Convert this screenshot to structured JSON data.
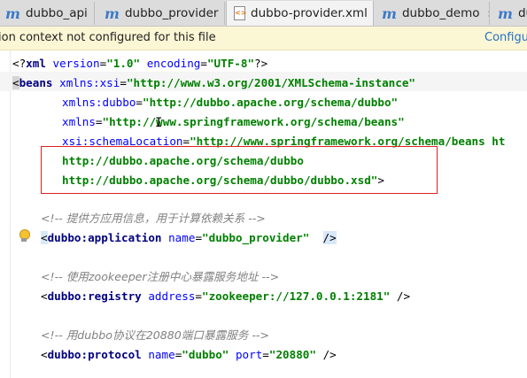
{
  "tabs": [
    {
      "label": "dubbo_api",
      "icon": "m-module-icon",
      "active": false
    },
    {
      "label": "dubbo_provider",
      "icon": "m-module-icon",
      "active": false
    },
    {
      "label": "dubbo-provider.xml",
      "icon": "xml-file-icon",
      "active": true
    },
    {
      "label": "dubbo_demo",
      "icon": "m-module-icon",
      "active": false
    },
    {
      "label": "du",
      "icon": "m-module-icon",
      "active": false
    }
  ],
  "close_glyph": "×",
  "notice": {
    "text": "ion context not configured for this file",
    "action": "Configu"
  },
  "code": {
    "l1": {
      "open": "<?",
      "tag": "xml",
      "a1": "version",
      "v1": "\"1.0\"",
      "a2": "encoding",
      "v2": "\"UTF-8\"",
      "close": "?>"
    },
    "l2": {
      "open": "<",
      "tag": "beans",
      "attr": "xmlns:xsi",
      "val": "\"http://www.w3.org/2001/XMLSchema-instance\""
    },
    "l3": {
      "attr": "xmlns:dubbo",
      "val": "\"http://dubbo.apache.org/schema/dubbo\""
    },
    "l4": {
      "attr": "xmlns",
      "val": "\"http://www.springframework.org/schema/beans\""
    },
    "l5": {
      "attr": "xsi:schemaLocation",
      "val": "\"http://www.springframework.org/schema/beans ht"
    },
    "l6": {
      "val": "http://dubbo.apache.org/schema/dubbo"
    },
    "l7": {
      "val": "http://dubbo.apache.org/schema/dubbo/dubbo.xsd\"",
      "close": ">"
    },
    "c1": "<!-- 提供方应用信息，用于计算依赖关系 -->",
    "l8": {
      "open": "<",
      "tag": "dubbo:application",
      "attr": "name",
      "val": "\"dubbo_provider\"",
      "close": "/>"
    },
    "c2": "<!-- 使用zookeeper注册中心暴露服务地址 -->",
    "l9": {
      "open": "<",
      "tag": "dubbo:registry",
      "attr": "address",
      "val": "\"zookeeper://127.0.0.1:2181\"",
      "close": "/>"
    },
    "c3": "<!-- 用dubbo协议在20880端口暴露服务 -->",
    "l10": {
      "open": "<",
      "tag": "dubbo:protocol",
      "attr": "name",
      "val": "\"dubbo\"",
      "attr2": "port",
      "val2": "\"20880\"",
      "close": "/>"
    }
  },
  "colors": {
    "tag": "#000080",
    "attribute": "#0000ff",
    "value": "#008000",
    "comment": "#808080",
    "annotation_box": "#e02020",
    "notice_bg": "#fbf6d4",
    "link": "#2470c2"
  }
}
